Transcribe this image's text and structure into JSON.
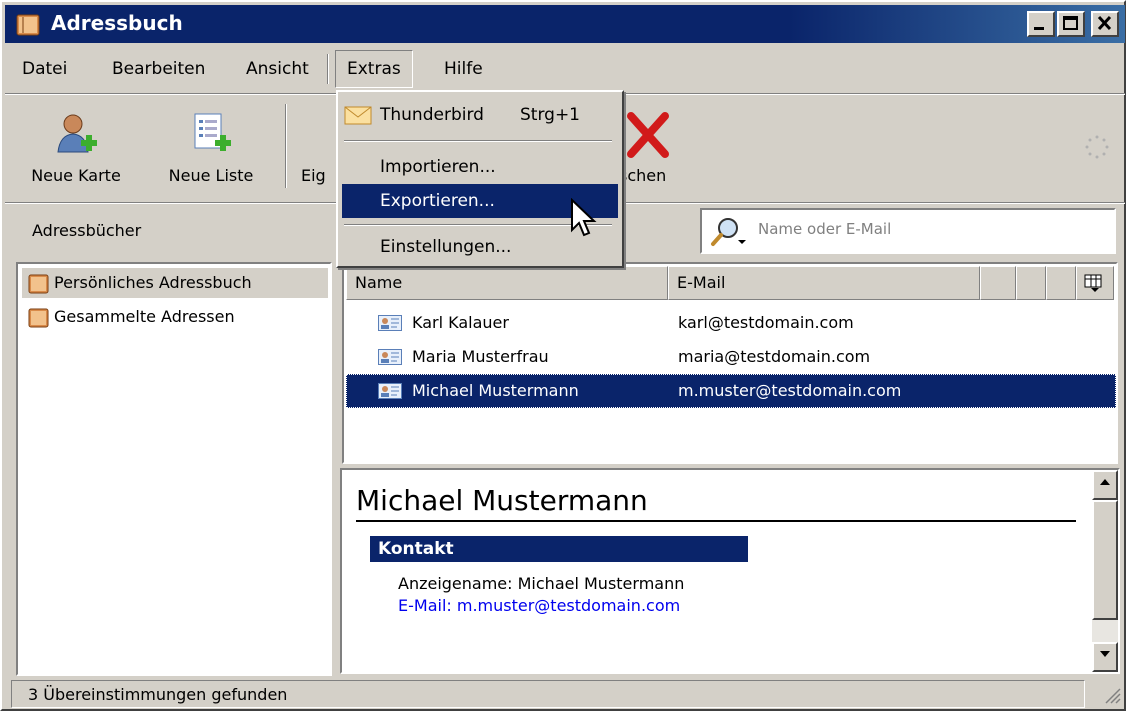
{
  "window": {
    "title": "Adressbuch",
    "controls": [
      "minimize",
      "maximize",
      "close"
    ]
  },
  "menubar": {
    "items": [
      {
        "id": "datei",
        "label": "Datei"
      },
      {
        "id": "bearbeiten",
        "label": "Bearbeiten"
      },
      {
        "id": "ansicht",
        "label": "Ansicht"
      },
      {
        "id": "extras",
        "label": "Extras"
      },
      {
        "id": "hilfe",
        "label": "Hilfe"
      }
    ],
    "open_menu": "Extras"
  },
  "extras_menu": {
    "thunderbird": {
      "label": "Thunderbird",
      "shortcut": "Strg+1"
    },
    "importieren": "Importieren...",
    "exportieren": "Exportieren...",
    "einstellungen": "Einstellungen...",
    "highlighted": "Exportieren..."
  },
  "toolbar": {
    "neue_karte": "Neue Karte",
    "neue_liste": "Neue Liste",
    "eigenschaften_partial": "Eig",
    "loeschen_partial": "schen"
  },
  "sidebar": {
    "header": "Adressbücher",
    "books": [
      {
        "label": "Persönliches Adressbuch",
        "selected": true
      },
      {
        "label": "Gesammelte Adressen",
        "selected": false
      }
    ]
  },
  "search": {
    "placeholder": "Name oder E-Mail"
  },
  "contacts": {
    "columns": [
      "Name",
      "E-Mail"
    ],
    "rows": [
      {
        "name": "Karl Kalauer",
        "email": "karl@testdomain.com",
        "selected": false
      },
      {
        "name": "Maria Musterfrau",
        "email": "maria@testdomain.com",
        "selected": false
      },
      {
        "name": "Michael Mustermann",
        "email": "m.muster@testdomain.com",
        "selected": true
      }
    ]
  },
  "card": {
    "name": "Michael Mustermann",
    "section": "Kontakt",
    "display_name_line": "Anzeigename: Michael Mustermann",
    "email_line": "E-Mail: m.muster@testdomain.com"
  },
  "status": {
    "text": "3 Übereinstimmungen gefunden"
  },
  "colors": {
    "titlebar": "#0a246a",
    "selection": "#0a246a",
    "face": "#d4d0c8",
    "link": "#0000ee"
  }
}
